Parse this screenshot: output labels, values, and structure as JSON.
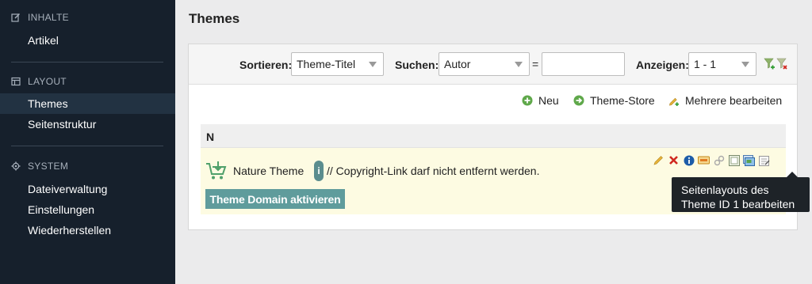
{
  "sidebar": {
    "sections": [
      {
        "title": "INHALTE",
        "icon": "edit-icon",
        "items": [
          "Artikel"
        ]
      },
      {
        "title": "LAYOUT",
        "icon": "layout-icon",
        "items": [
          "Themes",
          "Seitenstruktur"
        ]
      },
      {
        "title": "SYSTEM",
        "icon": "gear-icon",
        "items": [
          "Dateiverwaltung",
          "Einstellungen",
          "Wiederherstellen"
        ]
      }
    ],
    "active_item": "Themes"
  },
  "main": {
    "title": "Themes",
    "filter": {
      "sort_label": "Sortieren:",
      "sort_value": "Theme-Titel",
      "search_label": "Suchen:",
      "search_field_value": "Autor",
      "equals": "=",
      "search_text_value": "",
      "show_label": "Anzeigen:",
      "show_value": "1 - 1"
    },
    "actions": {
      "new": "Neu",
      "store": "Theme-Store",
      "bulk_edit": "Mehrere bearbeiten"
    },
    "table": {
      "header": "N",
      "row": {
        "name": "Nature Theme",
        "info": "i",
        "note": "// Copyright-Link darf nicht entfernt werden.",
        "activate": "Theme Domain aktivieren"
      }
    },
    "tooltip": {
      "line1": "Seitenlayouts des",
      "line2": "Theme ID 1 bearbeiten"
    }
  },
  "colors": {
    "sidebar_bg": "#16202c",
    "accent_green": "#5fa84a",
    "row_highlight": "#fdfbe2",
    "button_teal": "#5f9c9c"
  }
}
